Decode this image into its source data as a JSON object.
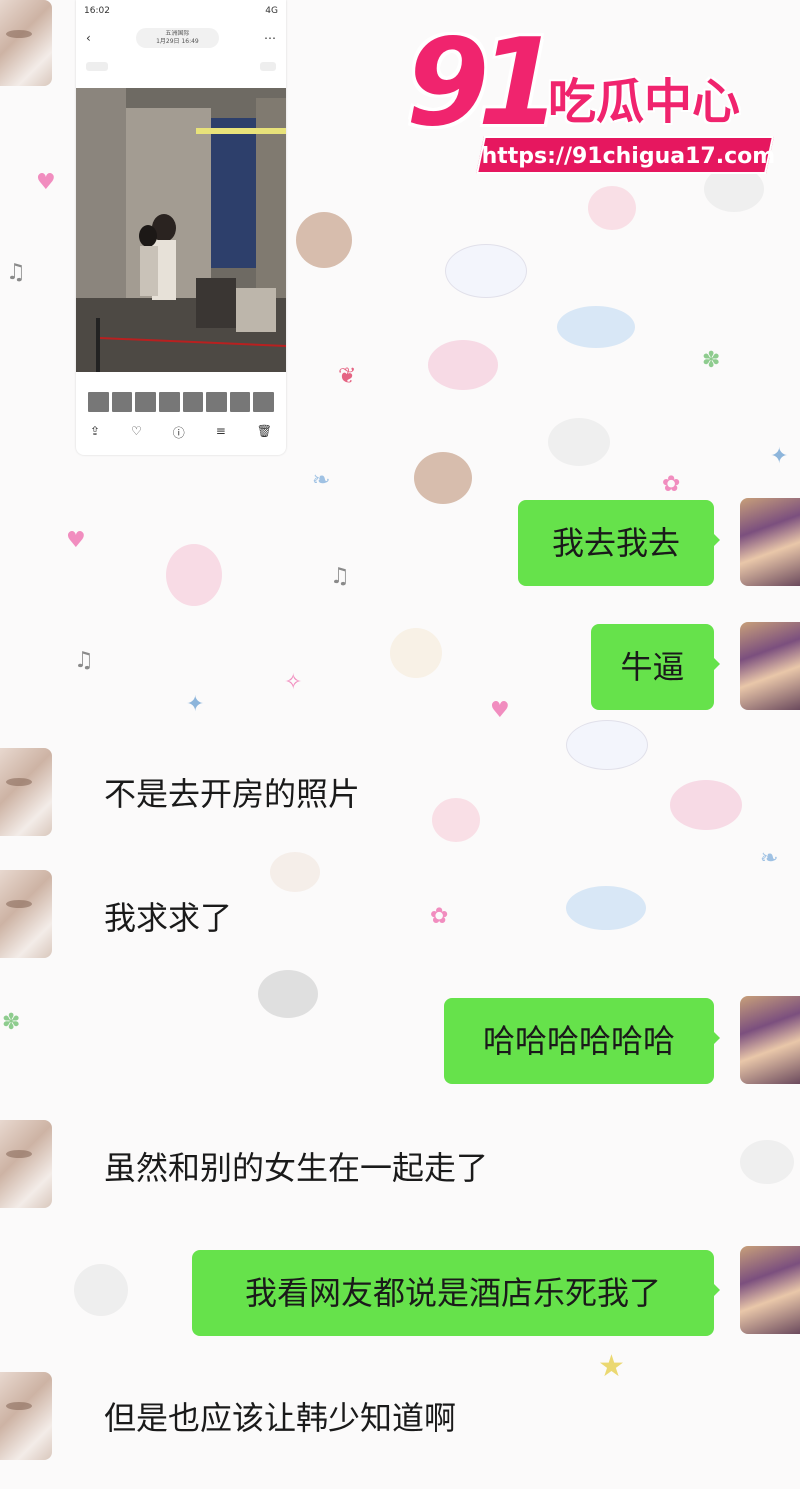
{
  "watermark": {
    "logo_number": "91",
    "logo_text": "吃瓜中心",
    "url": "https://91chigua17.com"
  },
  "screenshot": {
    "status_time": "16:02",
    "status_right": "4G",
    "nav_title_line1": "五洲国际",
    "nav_title_line2": "1月29日 16:49"
  },
  "messages": [
    {
      "side": "out",
      "text": "我去我去"
    },
    {
      "side": "out",
      "text": "牛逼"
    },
    {
      "side": "in",
      "text": "不是去开房的照片"
    },
    {
      "side": "in",
      "text": "我求求了"
    },
    {
      "side": "out",
      "text": "哈哈哈哈哈哈"
    },
    {
      "side": "in",
      "text": "虽然和别的女生在一起走了"
    },
    {
      "side": "out",
      "text": "我看网友都说是酒店乐死我了"
    },
    {
      "side": "in",
      "text": "但是也应该让韩少知道啊"
    }
  ],
  "colors": {
    "outgoing_bubble": "#66e24b",
    "logo_pink": "#f0246e",
    "background": "#fbfafa"
  }
}
